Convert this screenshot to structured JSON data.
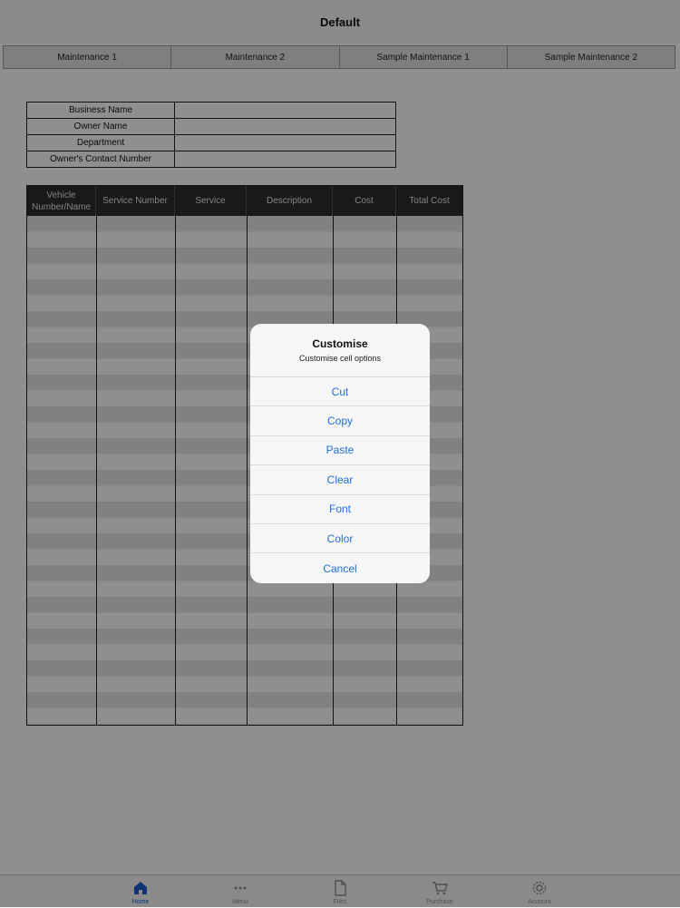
{
  "nav": {
    "title": "Default"
  },
  "sheet_tabs": [
    {
      "label": "Maintenance 1"
    },
    {
      "label": "Maintenance 2"
    },
    {
      "label": "Sample Maintenance 1"
    },
    {
      "label": "Sample Maintenance 2"
    }
  ],
  "info_fields": [
    {
      "label": "Business Name",
      "value": ""
    },
    {
      "label": "Owner Name",
      "value": ""
    },
    {
      "label": "Department",
      "value": ""
    },
    {
      "label": "Owner's Contact Number",
      "value": ""
    }
  ],
  "grid": {
    "columns": [
      {
        "label": "Vehicle Number/Name"
      },
      {
        "label": "Service Number"
      },
      {
        "label": "Service"
      },
      {
        "label": "Description"
      },
      {
        "label": "Cost"
      },
      {
        "label": "Total Cost"
      }
    ],
    "stripe_colors": [
      "#e6e6e6",
      "#ffffff"
    ]
  },
  "dialog": {
    "title": "Customise",
    "subtitle": "Customise cell options",
    "buttons": [
      {
        "label": "Cut"
      },
      {
        "label": "Copy"
      },
      {
        "label": "Paste"
      },
      {
        "label": "Clear"
      },
      {
        "label": "Font"
      },
      {
        "label": "Color"
      },
      {
        "label": "Cancel"
      }
    ],
    "button_color": "#1f6fd8"
  },
  "tabbar": {
    "items": [
      {
        "label": "Home",
        "icon": "home-icon",
        "active": true
      },
      {
        "label": "Menu",
        "icon": "more-dots-icon",
        "active": false
      },
      {
        "label": "Files",
        "icon": "file-icon",
        "active": false
      },
      {
        "label": "Purchase",
        "icon": "cart-icon",
        "active": false
      },
      {
        "label": "Account",
        "icon": "gear-icon",
        "active": false
      }
    ],
    "active_color": "#1a5bd1"
  }
}
